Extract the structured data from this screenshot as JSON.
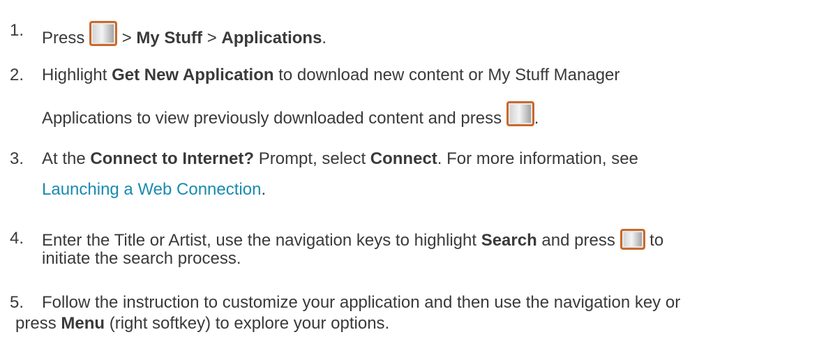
{
  "steps": [
    {
      "number": "1.",
      "t1": "Press",
      "t2": ">",
      "b1": "My Stuff",
      "t3": ">",
      "b2": "Applications",
      "t4": "."
    },
    {
      "number": "2.",
      "t1": "Highlight",
      "b1": "Get New Application",
      "t2": "to download new content or My Stuff Manager",
      "t3": "Applications to view previously downloaded content and press",
      "t4": "."
    },
    {
      "number": "3.",
      "t1": "At the",
      "b1": "Connect to Internet?",
      "t2": "Prompt, select",
      "b2": "Connect",
      "t3": ". For more information, see",
      "link": "Launching a Web Connection",
      "t4": "."
    },
    {
      "number": "4.",
      "t1": "Enter the Title or Artist, use the navigation keys to highlight",
      "b1": "Search",
      "t2": "and press",
      "t3": "to",
      "t4": "initiate the search process."
    },
    {
      "number": "5.",
      "t1": "Follow the instruction to customize your application and then use the navigation key or",
      "t2": "press",
      "b1": "Menu",
      "t3": "(right softkey) to explore your options."
    }
  ],
  "icons": {
    "key": "menu-ok-key-icon"
  }
}
